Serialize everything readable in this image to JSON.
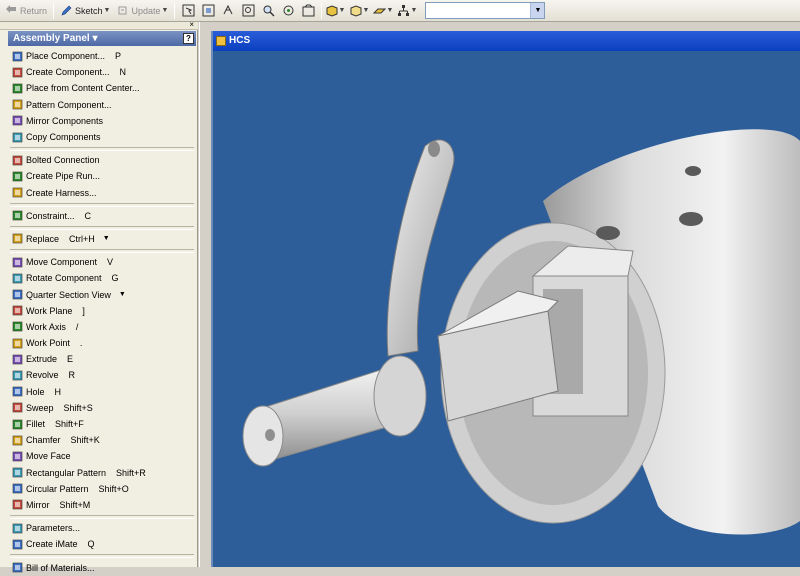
{
  "toolbar": {
    "return_label": "Return",
    "sketch_label": "Sketch",
    "update_label": "Update"
  },
  "panel": {
    "title": "Assembly Panel",
    "help_glyph": "?",
    "groups": [
      [
        {
          "label": "Place Component...",
          "shortcut": "P",
          "icon": "place-component-icon"
        },
        {
          "label": "Create Component...",
          "shortcut": "N",
          "icon": "create-component-icon"
        },
        {
          "label": "Place from Content Center...",
          "shortcut": "",
          "icon": "content-center-icon"
        },
        {
          "label": "Pattern Component...",
          "shortcut": "",
          "icon": "pattern-component-icon"
        },
        {
          "label": "Mirror Components",
          "shortcut": "",
          "icon": "mirror-components-icon"
        },
        {
          "label": "Copy Components",
          "shortcut": "",
          "icon": "copy-components-icon"
        }
      ],
      [
        {
          "label": "Bolted Connection",
          "shortcut": "",
          "icon": "bolted-connection-icon"
        },
        {
          "label": "Create Pipe Run...",
          "shortcut": "",
          "icon": "pipe-run-icon"
        },
        {
          "label": "Create Harness...",
          "shortcut": "",
          "icon": "harness-icon"
        }
      ],
      [
        {
          "label": "Constraint...",
          "shortcut": "C",
          "icon": "constraint-icon"
        }
      ],
      [
        {
          "label": "Replace",
          "shortcut": "Ctrl+H",
          "icon": "replace-icon",
          "dropdown": true
        }
      ],
      [
        {
          "label": "Move Component",
          "shortcut": "V",
          "icon": "move-component-icon"
        },
        {
          "label": "Rotate Component",
          "shortcut": "G",
          "icon": "rotate-component-icon"
        },
        {
          "label": "Quarter Section View",
          "shortcut": "",
          "icon": "section-view-icon",
          "dropdown": true
        },
        {
          "label": "Work Plane",
          "shortcut": "]",
          "icon": "work-plane-icon"
        },
        {
          "label": "Work Axis",
          "shortcut": "/",
          "icon": "work-axis-icon"
        },
        {
          "label": "Work Point",
          "shortcut": ".",
          "icon": "work-point-icon"
        },
        {
          "label": "Extrude",
          "shortcut": "E",
          "icon": "extrude-icon"
        },
        {
          "label": "Revolve",
          "shortcut": "R",
          "icon": "revolve-icon"
        },
        {
          "label": "Hole",
          "shortcut": "H",
          "icon": "hole-icon"
        },
        {
          "label": "Sweep",
          "shortcut": "Shift+S",
          "icon": "sweep-icon"
        },
        {
          "label": "Fillet",
          "shortcut": "Shift+F",
          "icon": "fillet-icon"
        },
        {
          "label": "Chamfer",
          "shortcut": "Shift+K",
          "icon": "chamfer-icon"
        },
        {
          "label": "Move Face",
          "shortcut": "",
          "icon": "move-face-icon"
        },
        {
          "label": "Rectangular Pattern",
          "shortcut": "Shift+R",
          "icon": "rectangular-pattern-icon"
        },
        {
          "label": "Circular Pattern",
          "shortcut": "Shift+O",
          "icon": "circular-pattern-icon"
        },
        {
          "label": "Mirror",
          "shortcut": "Shift+M",
          "icon": "mirror-icon"
        }
      ],
      [
        {
          "label": "Parameters...",
          "shortcut": "",
          "icon": "parameters-icon"
        },
        {
          "label": "Create iMate",
          "shortcut": "Q",
          "icon": "imate-icon"
        }
      ],
      [
        {
          "label": "Bill of Materials...",
          "shortcut": "",
          "icon": "bill-of-materials-icon"
        }
      ]
    ]
  },
  "viewport": {
    "title": "HCS",
    "background_color": "#2d5e9a",
    "title_color": "#0a3fbf"
  }
}
